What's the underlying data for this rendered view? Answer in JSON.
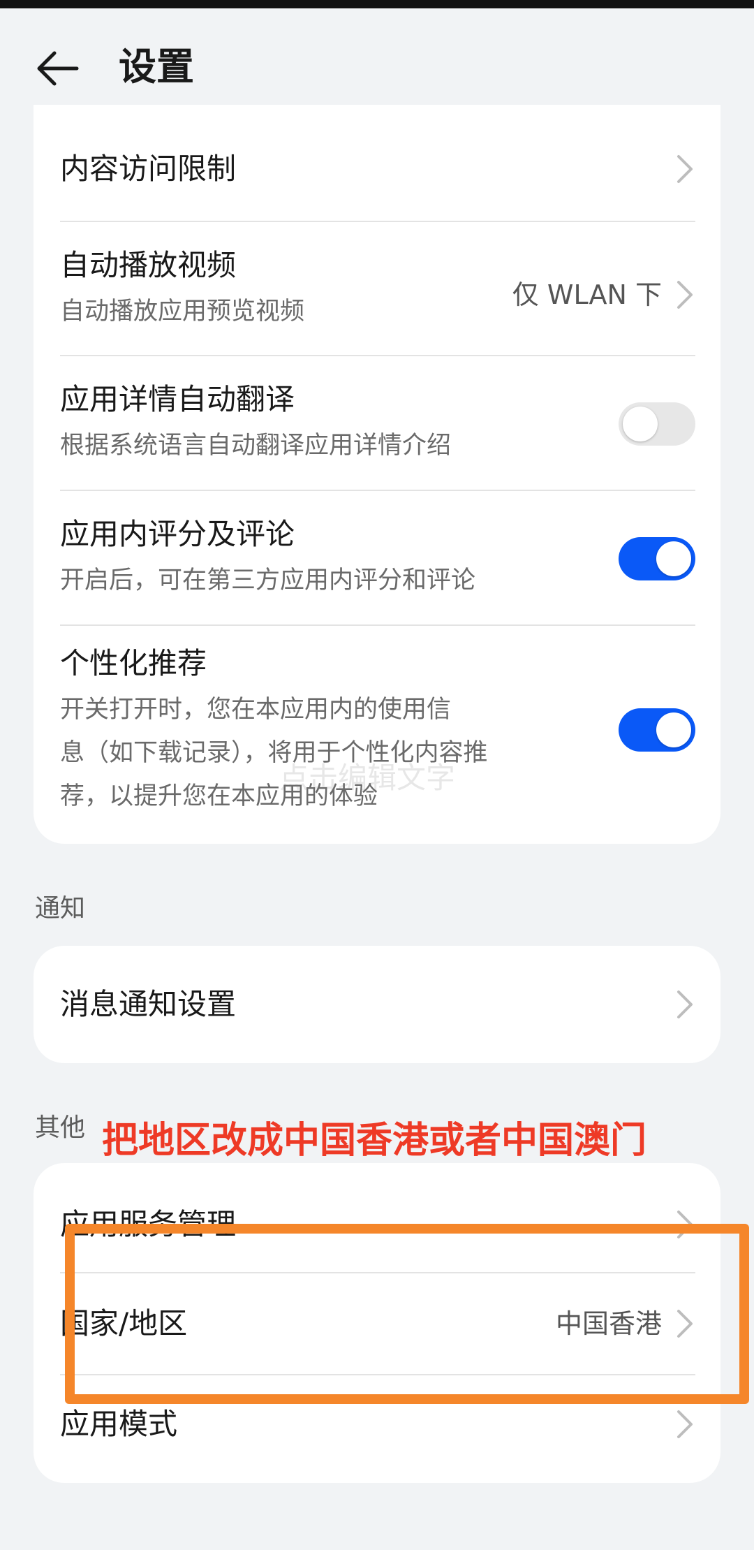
{
  "header": {
    "title": "设置"
  },
  "content_settings": {
    "items": [
      {
        "title": "内容访问限制"
      },
      {
        "title": "自动播放视频",
        "subtitle": "自动播放应用预览视频",
        "value": "仅 WLAN 下"
      },
      {
        "title": "应用详情自动翻译",
        "subtitle": "根据系统语言自动翻译应用详情介绍",
        "toggle": "off"
      },
      {
        "title": "应用内评分及评论",
        "subtitle": "开启后，可在第三方应用内评分和评论",
        "toggle": "on"
      },
      {
        "title": "个性化推荐",
        "subtitle_lines": [
          "开关打开时，您在本应用内的使用信",
          "息（如下载记录），将用于个性化内容推",
          "荐，以提升您在本应用的体验"
        ],
        "toggle": "on"
      }
    ]
  },
  "notifications": {
    "label": "通知",
    "items": [
      {
        "title": "消息通知设置"
      }
    ]
  },
  "others": {
    "label": "其他",
    "items": [
      {
        "title": "应用服务管理"
      },
      {
        "title": "国家/地区",
        "value": "中国香港"
      },
      {
        "title": "应用模式"
      }
    ]
  },
  "watermark": "点击编辑文字",
  "annotation": "把地区改成中国香港或者中国澳门",
  "colors": {
    "accent": "#0a59f7",
    "annotation": "#ee3a26",
    "highlight": "#f5862a",
    "background": "#f1f3f5"
  }
}
